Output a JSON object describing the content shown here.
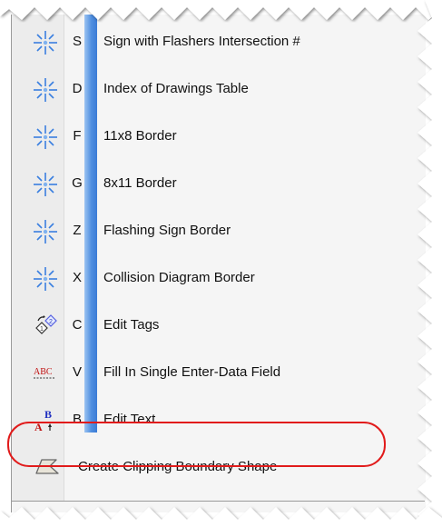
{
  "menu": {
    "items": [
      {
        "key": "S",
        "label": "Sign with Flashers Intersection #",
        "icon": "sparkle-icon"
      },
      {
        "key": "D",
        "label": "Index of Drawings Table",
        "icon": "sparkle-icon"
      },
      {
        "key": "F",
        "label": "11x8 Border",
        "icon": "sparkle-icon"
      },
      {
        "key": "G",
        "label": "8x11 Border",
        "icon": "sparkle-icon"
      },
      {
        "key": "Z",
        "label": "Flashing Sign Border",
        "icon": "sparkle-icon"
      },
      {
        "key": "X",
        "label": "Collision Diagram Border",
        "icon": "sparkle-icon"
      },
      {
        "key": "C",
        "label": "Edit Tags",
        "icon": "edit-tags-icon"
      },
      {
        "key": "V",
        "label": "Fill In Single Enter-Data Field",
        "icon": "enter-data-field-icon"
      },
      {
        "key": "B",
        "label": "Edit Text",
        "icon": "edit-text-icon"
      },
      {
        "key": "",
        "label": "Create Clipping Boundary Shape",
        "icon": "clipping-shape-icon"
      }
    ]
  },
  "icons": {
    "abc_text": "ABC",
    "letter_a": "A",
    "letter_b": "B"
  },
  "colors": {
    "key_strip": "#4f8fe0",
    "highlight": "#e11b1b",
    "sparkle": "#3a7fe0"
  }
}
